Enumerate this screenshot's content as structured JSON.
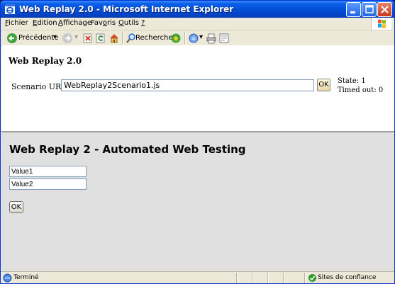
{
  "window": {
    "title": "Web Replay 2.0 - Microsoft Internet Explorer"
  },
  "menu": {
    "items": [
      {
        "key": "F",
        "rest": "ichier"
      },
      {
        "key": "E",
        "rest": "dition"
      },
      {
        "key": "A",
        "rest": "ffichage"
      },
      {
        "key": "",
        "rest": "Favoris",
        "pre": "Fav",
        "u": "o",
        "post": "ris"
      },
      {
        "key": "O",
        "rest": "utils"
      },
      {
        "key": "?",
        "rest": ""
      }
    ]
  },
  "toolbar": {
    "back_label": "Précédente",
    "search_label": "Rechercher"
  },
  "app": {
    "title": "Web Replay 2.0",
    "scenario_label": "Scenario URL:",
    "scenario_url": "WebReplay2Scenario1.js",
    "ok_label": "OK",
    "state": "State: 1",
    "timed_out": "Timed out: 0"
  },
  "page": {
    "heading": "Web Replay 2 - Automated Web Testing",
    "value1": "Value1",
    "value2": "Value2",
    "ok_label": "OK"
  },
  "status": {
    "text": "Terminé",
    "zone": "Sites de confiance"
  },
  "colors": {
    "titlebar": "#0450D8",
    "chrome": "#ECE9D8",
    "content_bg": "#E0E0E0"
  }
}
